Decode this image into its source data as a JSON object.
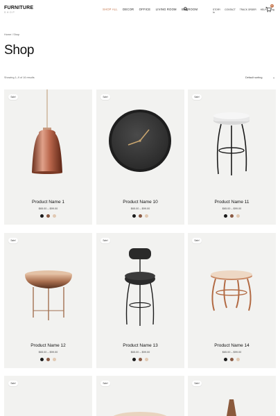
{
  "brand": {
    "name": "FURNITURE",
    "sub": "SHOP"
  },
  "nav": [
    "SHOP ALL",
    "DECOR",
    "OFFICE",
    "LIVING ROOM",
    "BEDROOM"
  ],
  "nav_active": "SHOP ALL",
  "right_nav": [
    "STORY",
    "CONTACT",
    "TRACK ORDER",
    "HELP",
    "Log In"
  ],
  "cart_count": "0",
  "breadcrumb": "Home / Shop",
  "page_title": "Shop",
  "results": "Showing 1–9 of 16 results",
  "sort_label": "Default sorting",
  "sale_label": "Sale!",
  "products": [
    {
      "name": "Product Name 1",
      "price": "$65.00 – $99.00",
      "swatches": [
        "#1a1a1a",
        "#8a5a44",
        "#e1c9b3"
      ]
    },
    {
      "name": "Product Name 10",
      "price": "$65.00 – $99.00",
      "swatches": [
        "#1a1a1a",
        "#8a5a44",
        "#e1c9b3"
      ]
    },
    {
      "name": "Product Name 11",
      "price": "$65.00 – $99.00",
      "swatches": [
        "#1a1a1a",
        "#8a5a44",
        "#e1c9b3"
      ]
    },
    {
      "name": "Product Name 12",
      "price": "$65.00 – $99.00",
      "swatches": [
        "#1a1a1a",
        "#8a5a44",
        "#e1c9b3"
      ]
    },
    {
      "name": "Product Name 13",
      "price": "$65.00 – $99.00",
      "swatches": [
        "#1a1a1a",
        "#8a5a44",
        "#e1c9b3"
      ]
    },
    {
      "name": "Product Name 14",
      "price": "$65.00 – $99.00",
      "swatches": [
        "#1a1a1a",
        "#8a5a44",
        "#e1c9b3"
      ]
    }
  ],
  "colors": {
    "accent": "#c87a52",
    "card_bg": "#f2f2f0"
  }
}
